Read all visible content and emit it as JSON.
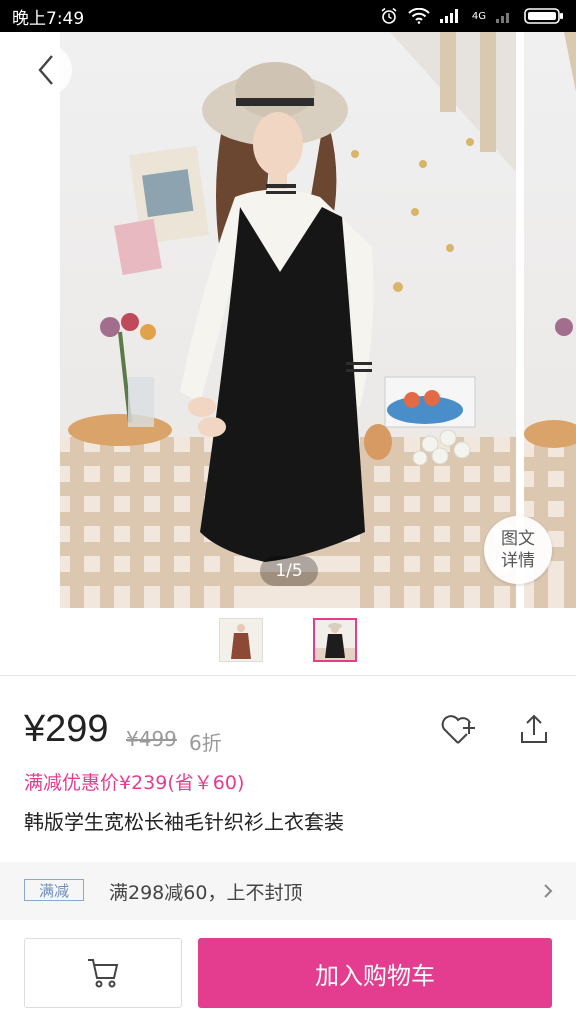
{
  "status_bar": {
    "time": "晚上7:49",
    "network_label": "4G"
  },
  "gallery": {
    "counter": "1/5",
    "detail_button_line1": "图文",
    "detail_button_line2": "详情"
  },
  "product": {
    "price": "¥299",
    "original_price": "¥499",
    "discount": "6折",
    "promo_price": "满减优惠价¥239(省￥60)",
    "title": "韩版学生宽松长袖毛针织衫上衣套装"
  },
  "promotion": {
    "tag": "满减",
    "text": "满298减60，上不封顶"
  },
  "actions": {
    "add_to_cart": "加入购物车"
  },
  "colors": {
    "accent": "#e43d8f",
    "tag_border": "#8ba8d0"
  },
  "icons": [
    "back-arrow-icon",
    "favorite-add-icon",
    "share-icon",
    "chevron-right-icon",
    "shopping-cart-icon",
    "alarm-icon",
    "wifi-icon",
    "battery-icon"
  ]
}
